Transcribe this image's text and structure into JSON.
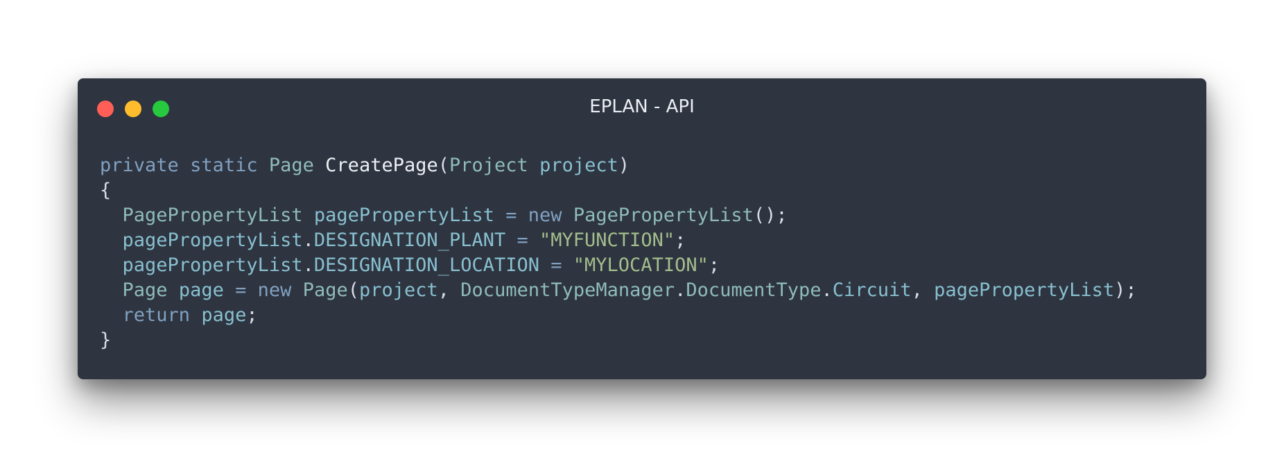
{
  "window": {
    "title": "EPLAN - API",
    "controls": {
      "close_icon": "close-dot-icon",
      "minimize_icon": "minimize-dot-icon",
      "maximize_icon": "maximize-dot-icon",
      "close_color": "#ff5f56",
      "minimize_color": "#ffbd2e",
      "maximize_color": "#27c93f"
    },
    "background_color": "#2e3440"
  },
  "code": {
    "language": "csharp",
    "lines": [
      [
        {
          "t": "private",
          "c": "kw"
        },
        {
          "t": " ",
          "c": "pl"
        },
        {
          "t": "static",
          "c": "kw"
        },
        {
          "t": " ",
          "c": "pl"
        },
        {
          "t": "Page",
          "c": "ty"
        },
        {
          "t": " ",
          "c": "pl"
        },
        {
          "t": "CreatePage",
          "c": "fn"
        },
        {
          "t": "(",
          "c": "pl"
        },
        {
          "t": "Project",
          "c": "ty"
        },
        {
          "t": " ",
          "c": "pl"
        },
        {
          "t": "project",
          "c": "id"
        },
        {
          "t": ")",
          "c": "pl"
        }
      ],
      [
        {
          "t": "{",
          "c": "pl"
        }
      ],
      [
        {
          "t": "  ",
          "c": "pl"
        },
        {
          "t": "PagePropertyList",
          "c": "ty"
        },
        {
          "t": " ",
          "c": "pl"
        },
        {
          "t": "pagePropertyList",
          "c": "id"
        },
        {
          "t": " ",
          "c": "pl"
        },
        {
          "t": "=",
          "c": "op"
        },
        {
          "t": " ",
          "c": "pl"
        },
        {
          "t": "new",
          "c": "kw"
        },
        {
          "t": " ",
          "c": "pl"
        },
        {
          "t": "PagePropertyList",
          "c": "ty"
        },
        {
          "t": "();",
          "c": "pl"
        }
      ],
      [
        {
          "t": "  ",
          "c": "pl"
        },
        {
          "t": "pagePropertyList",
          "c": "id"
        },
        {
          "t": ".",
          "c": "pl"
        },
        {
          "t": "DESIGNATION_PLANT",
          "c": "id"
        },
        {
          "t": " ",
          "c": "pl"
        },
        {
          "t": "=",
          "c": "op"
        },
        {
          "t": " ",
          "c": "pl"
        },
        {
          "t": "\"MYFUNCTION\"",
          "c": "st"
        },
        {
          "t": ";",
          "c": "pl"
        }
      ],
      [
        {
          "t": "  ",
          "c": "pl"
        },
        {
          "t": "pagePropertyList",
          "c": "id"
        },
        {
          "t": ".",
          "c": "pl"
        },
        {
          "t": "DESIGNATION_LOCATION",
          "c": "id"
        },
        {
          "t": " ",
          "c": "pl"
        },
        {
          "t": "=",
          "c": "op"
        },
        {
          "t": " ",
          "c": "pl"
        },
        {
          "t": "\"MYLOCATION\"",
          "c": "st"
        },
        {
          "t": ";",
          "c": "pl"
        }
      ],
      [
        {
          "t": "  ",
          "c": "pl"
        },
        {
          "t": "Page",
          "c": "ty"
        },
        {
          "t": " ",
          "c": "pl"
        },
        {
          "t": "page",
          "c": "id"
        },
        {
          "t": " ",
          "c": "pl"
        },
        {
          "t": "=",
          "c": "op"
        },
        {
          "t": " ",
          "c": "pl"
        },
        {
          "t": "new",
          "c": "kw"
        },
        {
          "t": " ",
          "c": "pl"
        },
        {
          "t": "Page",
          "c": "ty"
        },
        {
          "t": "(",
          "c": "pl"
        },
        {
          "t": "project",
          "c": "id"
        },
        {
          "t": ", ",
          "c": "pl"
        },
        {
          "t": "DocumentTypeManager",
          "c": "ty"
        },
        {
          "t": ".",
          "c": "pl"
        },
        {
          "t": "DocumentType",
          "c": "ty"
        },
        {
          "t": ".",
          "c": "pl"
        },
        {
          "t": "Circuit",
          "c": "id"
        },
        {
          "t": ", ",
          "c": "pl"
        },
        {
          "t": "pagePropertyList",
          "c": "id"
        },
        {
          "t": ");",
          "c": "pl"
        }
      ],
      [
        {
          "t": "  ",
          "c": "pl"
        },
        {
          "t": "return",
          "c": "kw"
        },
        {
          "t": " ",
          "c": "pl"
        },
        {
          "t": "page",
          "c": "id"
        },
        {
          "t": ";",
          "c": "pl"
        }
      ],
      [
        {
          "t": "}",
          "c": "pl"
        }
      ]
    ]
  }
}
